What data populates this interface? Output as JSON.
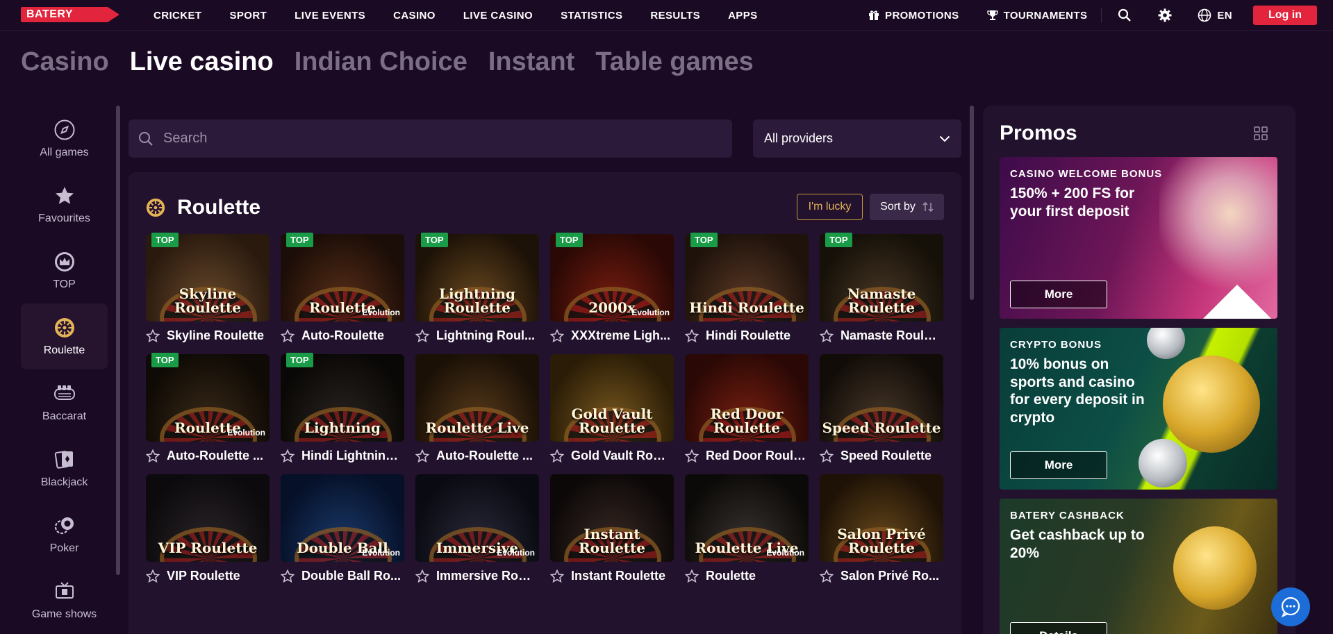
{
  "header": {
    "logo": "BATERY",
    "nav": [
      "CRICKET",
      "SPORT",
      "LIVE EVENTS",
      "CASINO",
      "LIVE CASINO",
      "STATISTICS",
      "RESULTS",
      "APPS"
    ],
    "promotions": "PROMOTIONS",
    "tournaments": "TOURNAMENTS",
    "language": "EN",
    "login": "Log in"
  },
  "tabs": [
    "Casino",
    "Live casino",
    "Indian Choice",
    "Instant",
    "Table games"
  ],
  "sidebar": [
    "All games",
    "Favourites",
    "TOP",
    "Roulette",
    "Baccarat",
    "Blackjack",
    "Poker",
    "Game shows"
  ],
  "search": {
    "placeholder": "Search"
  },
  "providers": {
    "selected": "All providers"
  },
  "category": {
    "title": "Roulette",
    "lucky": "I'm lucky",
    "sort": "Sort by"
  },
  "badge_top": "TOP",
  "games": [
    {
      "name": "Skyline Roulette",
      "art": "Skyline Roulette",
      "top": true,
      "evo": ""
    },
    {
      "name": "Auto-Roulette",
      "art": "Roulette",
      "top": true,
      "evo": "Evolution"
    },
    {
      "name": "Lightning Roul...",
      "art": "Lightning Roulette",
      "top": true,
      "evo": ""
    },
    {
      "name": "XXXtreme Ligh...",
      "art": "2000x",
      "top": true,
      "evo": "Evolution"
    },
    {
      "name": "Hindi Roulette",
      "art": "Hindi Roulette",
      "top": true,
      "evo": ""
    },
    {
      "name": "Namaste Roule...",
      "art": "Namaste Roulette",
      "top": true,
      "evo": ""
    },
    {
      "name": "Auto-Roulette ...",
      "art": "Roulette",
      "top": true,
      "evo": "Evolution"
    },
    {
      "name": "Hindi Lightning...",
      "art": "Lightning",
      "top": true,
      "evo": ""
    },
    {
      "name": "Auto-Roulette ...",
      "art": "Roulette Live",
      "top": false,
      "evo": ""
    },
    {
      "name": "Gold Vault Roul...",
      "art": "Gold Vault Roulette",
      "top": false,
      "evo": ""
    },
    {
      "name": "Red Door Roule...",
      "art": "Red Door Roulette",
      "top": false,
      "evo": ""
    },
    {
      "name": "Speed Roulette",
      "art": "Speed Roulette",
      "top": false,
      "evo": ""
    },
    {
      "name": "VIP Roulette",
      "art": "VIP Roulette",
      "top": false,
      "evo": ""
    },
    {
      "name": "Double Ball Ro...",
      "art": "Double Ball",
      "top": false,
      "evo": "Evolution"
    },
    {
      "name": "Immersive Roul...",
      "art": "Immersive",
      "top": false,
      "evo": "Evolution"
    },
    {
      "name": "Instant Roulette",
      "art": "Instant Roulette",
      "top": false,
      "evo": ""
    },
    {
      "name": "Roulette",
      "art": "Roulette Live",
      "top": false,
      "evo": "Evolution"
    },
    {
      "name": "Salon Privé Ro...",
      "art": "Salon Privé Roulette",
      "top": false,
      "evo": ""
    }
  ],
  "promos": {
    "title": "Promos",
    "items": [
      {
        "label": "CASINO WELCOME BONUS",
        "desc": "150% + 200 FS for your first deposit",
        "button": "More"
      },
      {
        "label": "CRYPTO BONUS",
        "desc": "10% bonus on sports and casino for every deposit in crypto",
        "button": "More"
      },
      {
        "label": "BATERY CASHBACK",
        "desc": "Get cashback up to 20%",
        "button": "Details"
      }
    ]
  },
  "colors": {
    "accent": "#e2243d",
    "top_badge": "#1a9b47",
    "background": "#1a0a24"
  }
}
